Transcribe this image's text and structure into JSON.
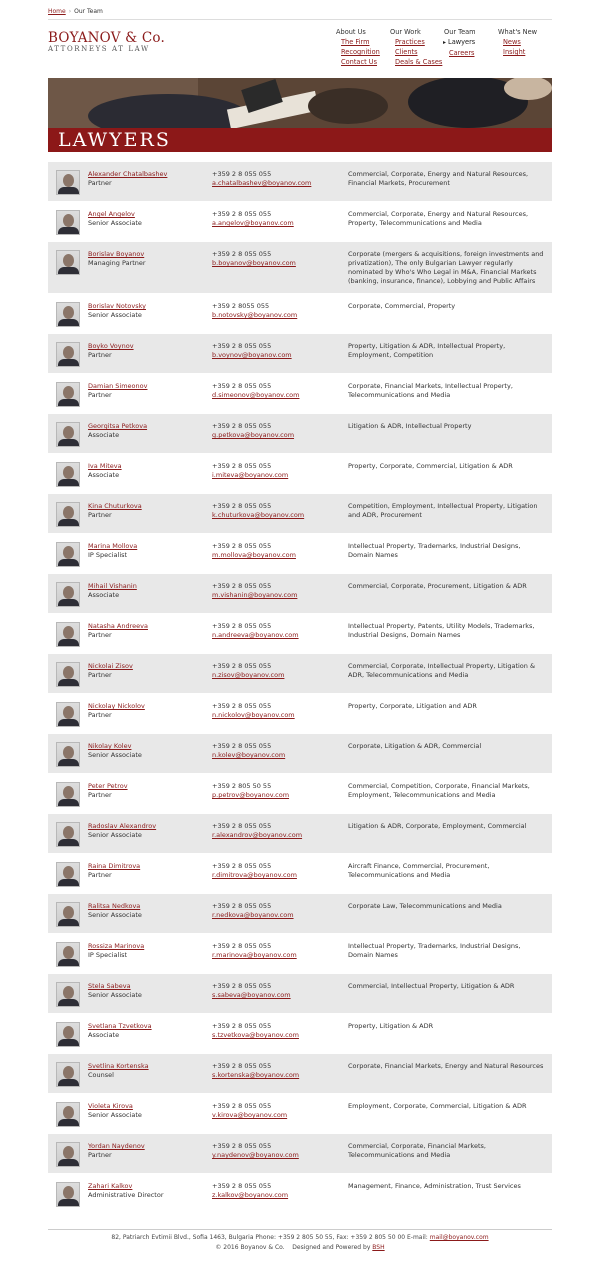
{
  "breadcrumb": {
    "home": "Home",
    "current": "Our Team"
  },
  "logo": {
    "name": "BOYANOV & Co.",
    "subtitle": "ATTORNEYS AT LAW"
  },
  "nav": [
    {
      "heading": "About Us",
      "items": [
        {
          "label": "The Firm"
        },
        {
          "label": "Recognition"
        },
        {
          "label": "Contact Us"
        }
      ]
    },
    {
      "heading": "Our Work",
      "items": [
        {
          "label": "Practices"
        },
        {
          "label": "Clients"
        },
        {
          "label": "Deals & Cases"
        }
      ]
    },
    {
      "heading": "Our Team",
      "items": [
        {
          "label": "Lawyers",
          "active": true
        },
        {
          "label": "Careers"
        }
      ]
    },
    {
      "heading": "What's New",
      "items": [
        {
          "label": "News"
        },
        {
          "label": "Insight"
        }
      ]
    }
  ],
  "banner": {
    "title": "LAWYERS"
  },
  "lawyers": [
    {
      "name": "Alexander Chatalbashev",
      "role": "Partner",
      "phone": "+359 2 8 055 055",
      "email": "a.chatalbashev@boyanov.com",
      "areas": "Commercial, Corporate, Energy and Natural Resources, Financial Markets, Procurement"
    },
    {
      "name": "Angel Angelov",
      "role": "Senior Associate",
      "phone": "+359 2 8 055 055",
      "email": "a.angelov@boyanov.com",
      "areas": "Commercial, Corporate, Energy and Natural Resources, Property, Telecommunications and Media"
    },
    {
      "name": "Borislav Boyanov",
      "role": "Managing Partner",
      "phone": "+359 2 8 055 055",
      "email": "b.boyanov@boyanov.com",
      "areas": "Corporate (mergers & acquisitions, foreign investments and privatization), The only Bulgarian Lawyer regularly nominated by Who's Who Legal in M&A, Financial Markets (banking, insurance, finance), Lobbying and Public Affairs"
    },
    {
      "name": "Borislav Notovsky",
      "role": "Senior Associate",
      "phone": "+359 2 8055 055",
      "email": "b.notovsky@boyanov.com",
      "areas": "Corporate, Commercial, Property"
    },
    {
      "name": "Boyko Voynov",
      "role": "Partner",
      "phone": "+359 2 8 055 055",
      "email": "b.voynov@boyanov.com",
      "areas": "Property, Litigation & ADR, Intellectual Property, Employment, Competition"
    },
    {
      "name": "Damian Simeonov",
      "role": "Partner",
      "phone": "+359 2 8 055 055",
      "email": "d.simeonov@boyanov.com",
      "areas": "Corporate, Financial Markets, Intellectual Property, Telecommunications and Media"
    },
    {
      "name": "Georgitsa Petkova",
      "role": "Associate",
      "phone": "+359 2 8 055 055",
      "email": "g.petkova@boyanov.com",
      "areas": "Litigation & ADR, Intellectual Property"
    },
    {
      "name": "Iva Miteva",
      "role": "Associate",
      "phone": "+359 2 8 055 055",
      "email": "i.miteva@boyanov.com",
      "areas": "Property, Corporate, Commercial, Litigation & ADR"
    },
    {
      "name": "Kina Chuturkova",
      "role": "Partner",
      "phone": "+359 2 8 055 055",
      "email": "k.chuturkova@boyanov.com",
      "areas": "Competition, Employment, Intellectual Property, Litigation and ADR, Procurement"
    },
    {
      "name": "Marina Mollova",
      "role": "IP Specialist",
      "phone": "+359 2 8 055 055",
      "email": "m.mollova@boyanov.com",
      "areas": "Intellectual Property, Trademarks, Industrial Designs, Domain Names"
    },
    {
      "name": "Mihail Vishanin",
      "role": "Associate",
      "phone": "+359 2 8 055 055",
      "email": "m.vishanin@boyanov.com",
      "areas": "Commercial, Corporate, Procurement, Litigation & ADR"
    },
    {
      "name": "Natasha Andreeva",
      "role": "Partner",
      "phone": "+359 2 8 055 055",
      "email": "n.andreeva@boyanov.com",
      "areas": "Intellectual Property, Patents, Utility Models, Trademarks, Industrial Designs, Domain Names"
    },
    {
      "name": "Nickolai Zisov",
      "role": "Partner",
      "phone": "+359 2 8 055 055",
      "email": "n.zisov@boyanov.com",
      "areas": "Commercial, Corporate, Intellectual Property, Litigation & ADR, Telecommunications and Media"
    },
    {
      "name": "Nickolay Nickolov",
      "role": "Partner",
      "phone": "+359 2 8 055 055",
      "email": "n.nickolov@boyanov.com",
      "areas": "Property, Corporate, Litigation and ADR"
    },
    {
      "name": "Nikolay Kolev",
      "role": "Senior Associate",
      "phone": "+359 2 8 055 055",
      "email": "n.kolev@boyanov.com",
      "areas": "Corporate, Litigation & ADR, Commercial"
    },
    {
      "name": "Peter Petrov",
      "role": "Partner",
      "phone": "+359 2 805 50 55",
      "email": "p.petrov@boyanov.com",
      "areas": "Commercial, Competition, Corporate, Financial Markets, Employment, Telecommunications and Media"
    },
    {
      "name": "Radoslav Alexandrov",
      "role": "Senior Associate",
      "phone": "+359 2 8 055 055",
      "email": "r.alexandrov@boyanov.com",
      "areas": "Litigation & ADR, Corporate, Employment, Commercial"
    },
    {
      "name": "Raina Dimitrova",
      "role": "Partner",
      "phone": "+359 2 8 055 055",
      "email": "r.dimitrova@boyanov.com",
      "areas": "Aircraft Finance, Commercial, Procurement, Telecommunications and Media"
    },
    {
      "name": "Ralitsa Nedkova",
      "role": "Senior Associate",
      "phone": "+359 2 8 055 055",
      "email": "r.nedkova@boyanov.com",
      "areas": "Corporate Law, Telecommunications and Media"
    },
    {
      "name": "Rossiza Marinova",
      "role": "IP Specialist",
      "phone": "+359 2 8 055 055",
      "email": "r.marinova@boyanov.com",
      "areas": "Intellectual Property, Trademarks, Industrial Designs, Domain Names"
    },
    {
      "name": "Stela Sabeva",
      "role": "Senior Associate",
      "phone": "+359 2 8 055 055",
      "email": "s.sabeva@boyanov.com",
      "areas": "Commercial, Intellectual Property, Litigation & ADR"
    },
    {
      "name": "Svetlana Tzvetkova",
      "role": "Associate",
      "phone": "+359 2 8 055 055",
      "email": "s.tzvetkova@boyanov.com",
      "areas": "Property, Litigation & ADR"
    },
    {
      "name": "Svetlina Kortenska",
      "role": "Counsel",
      "phone": "+359 2 8 055 055",
      "email": "s.kortenska@boyanov.com",
      "areas": "Corporate, Financial Markets, Energy and Natural Resources"
    },
    {
      "name": "Violeta Kirova",
      "role": "Senior Associate",
      "phone": "+359 2 8 055 055",
      "email": "v.kirova@boyanov.com",
      "areas": "Employment, Corporate, Commercial, Litigation & ADR"
    },
    {
      "name": "Yordan Naydenov",
      "role": "Partner",
      "phone": "+359 2 8 055 055",
      "email": "y.naydenov@boyanov.com",
      "areas": "Commercial, Corporate, Financial Markets, Telecommunications and Media"
    },
    {
      "name": "Zahari Kalkov",
      "role": "Administrative Director",
      "phone": "+359 2 8 055 055",
      "email": "z.kalkov@boyanov.com",
      "areas": "Management, Finance, Administration, Trust Services"
    }
  ],
  "footer": {
    "address": "82, Patriarch Evtimii Blvd., Sofia 1463, Bulgaria Phone: +359 2 805 50 55, Fax: +359 2 805 50 00 E-mail:",
    "email": "mail@boyanov.com",
    "copyright": "© 2016 Boyanov & Co.",
    "powered": "Designed and Powered by",
    "powered_by": "BSH"
  },
  "colors": {
    "brand": "#8b1a1a",
    "row_shade": "#e8e8e8"
  }
}
